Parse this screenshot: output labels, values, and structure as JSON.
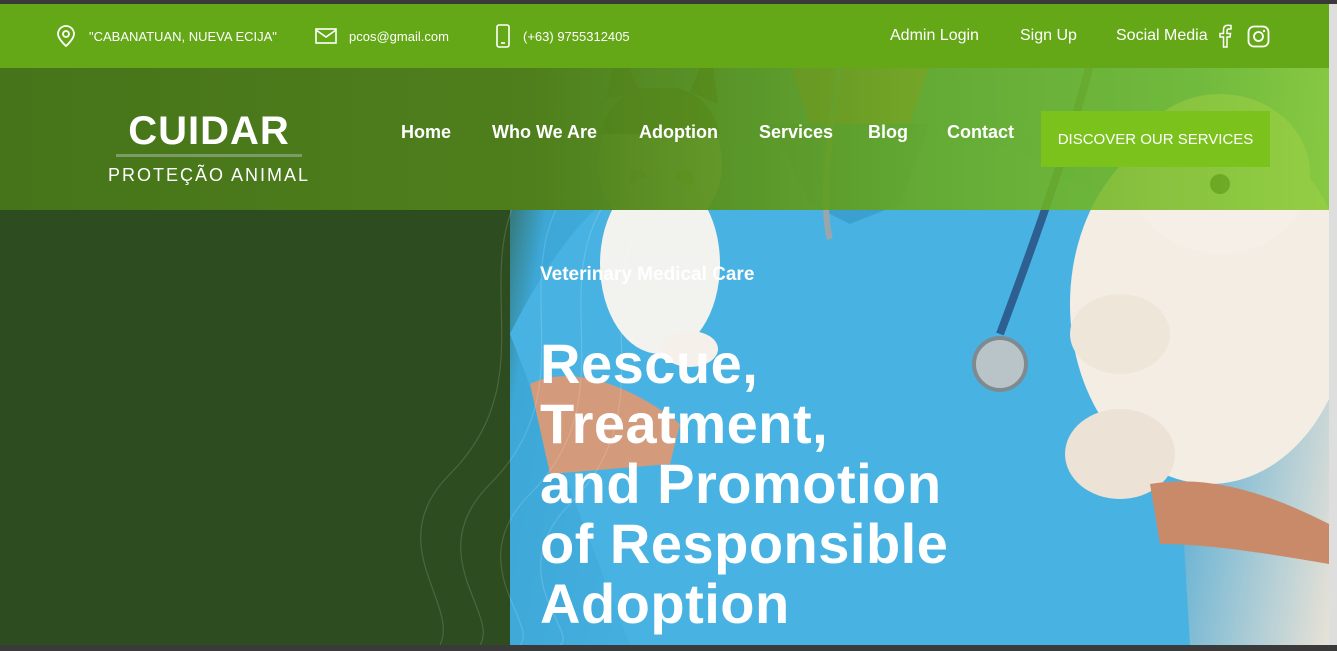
{
  "topbar": {
    "address": "\"CABANATUAN, NUEVA ECIJA\"",
    "email": "pcos@gmail.com",
    "phone": "(+63) 9755312405",
    "admin_login": "Admin Login",
    "sign_up": "Sign Up",
    "social_media": "Social Media",
    "icons": [
      "location-pin-icon",
      "mail-icon",
      "phone-icon",
      "facebook-icon",
      "instagram-icon"
    ]
  },
  "logo": {
    "main": "CUIDAR",
    "sub": "PROTEÇÃO ANIMAL"
  },
  "nav": {
    "items": [
      "Home",
      "Who We Are",
      "Adoption",
      "Services",
      "Blog",
      "Contact"
    ],
    "cta": "DISCOVER OUR SERVICES"
  },
  "hero": {
    "eyebrow": "Veterinary Medical Care",
    "title_lines": [
      "Rescue,",
      "Treatment,",
      "and Promotion",
      "of Responsible",
      "Adoption"
    ]
  },
  "colors": {
    "topbar": "#64a817",
    "navbar": "#4f7f1c",
    "cta": "#7cc21c",
    "hero_bg": "#2d4c1f",
    "scrubs": "#4bb6e4"
  }
}
